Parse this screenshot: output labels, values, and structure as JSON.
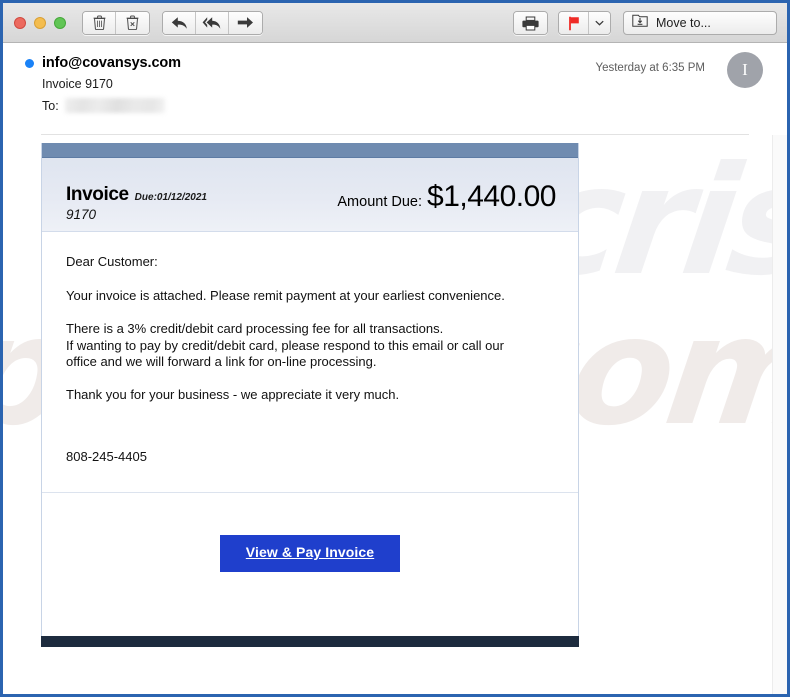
{
  "window": {
    "traffic_lights": [
      "close",
      "minimize",
      "zoom"
    ]
  },
  "toolbar": {
    "delete_icon": "trash-icon",
    "junk_icon": "junk-trash-icon",
    "reply_icon": "reply-arrow-icon",
    "reply_all_icon": "reply-all-arrow-icon",
    "forward_icon": "forward-arrow-icon",
    "print_icon": "printer-icon",
    "flag_icon": "red-flag-icon",
    "flag_dropdown_icon": "chevron-down-icon",
    "move_to_icon": "move-to-folder-icon",
    "move_to_label": "Move to...",
    "flag_color": "#ef2b26"
  },
  "message": {
    "sender": "info@covansys.com",
    "subject": "Invoice 9170",
    "to_label": "To:",
    "to_value": "",
    "timestamp": "Yesterday at 6:35 PM",
    "avatar_initial": "I",
    "unread_color": "#1a82f7"
  },
  "invoice": {
    "title": "Invoice",
    "due_label": "Due:01/12/2021",
    "number": "9170",
    "amount_label": "Amount Due:",
    "amount_value": "$1,440.00",
    "greeting": "Dear Customer:",
    "para1": "Your invoice is attached. Please remit payment at your earliest convenience.",
    "para2_line1": "There is a 3% credit/debit card processing fee for all transactions.",
    "para2_line2": "If wanting to pay by credit/debit card, please respond to this email or call our",
    "para2_line3": "office and we will forward a link for on-line processing.",
    "para3": "Thank you for your business - we appreciate it very much.",
    "phone": "808-245-4405",
    "cta_label": "View & Pay Invoice",
    "accent_top_bar": "#6f8bb0",
    "accent_bottom_bar": "#1d2b3e",
    "cta_color": "#1f3fcc"
  },
  "watermark": {
    "text_main": "pcrisk.com",
    "text_top": "pcrisk"
  }
}
